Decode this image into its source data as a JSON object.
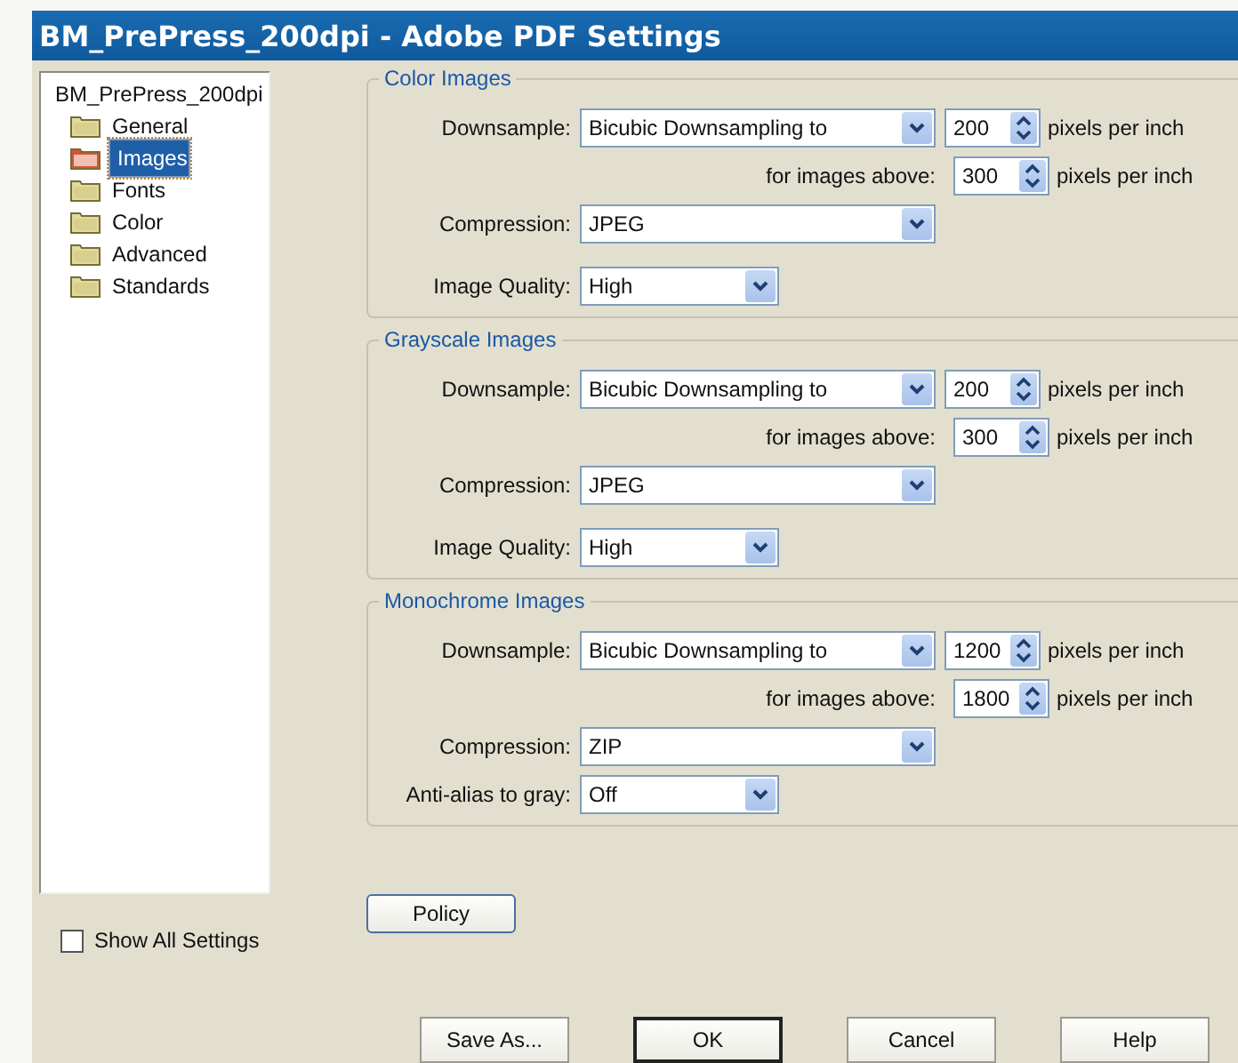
{
  "window": {
    "title": "BM_PrePress_200dpi - Adobe PDF Settings"
  },
  "tree": {
    "root": "BM_PrePress_200dpi",
    "items": [
      {
        "label": "General",
        "selected": false
      },
      {
        "label": "Images",
        "selected": true
      },
      {
        "label": "Fonts",
        "selected": false
      },
      {
        "label": "Color",
        "selected": false
      },
      {
        "label": "Advanced",
        "selected": false
      },
      {
        "label": "Standards",
        "selected": false
      }
    ]
  },
  "show_all_settings": {
    "label": "Show All Settings",
    "checked": false
  },
  "sections": [
    {
      "title": "Color Images",
      "rows": [
        {
          "kind": "select-spin",
          "label": "Downsample:",
          "value": "Bicubic Downsampling to",
          "number": "200",
          "unit": "pixels per inch"
        },
        {
          "kind": "spin",
          "label": "for images above:",
          "number": "300",
          "unit": "pixels per inch"
        },
        {
          "kind": "select-long",
          "label": "Compression:",
          "value": "JPEG"
        },
        {
          "kind": "select-short",
          "label": "Image Quality:",
          "value": "High"
        }
      ]
    },
    {
      "title": "Grayscale Images",
      "rows": [
        {
          "kind": "select-spin",
          "label": "Downsample:",
          "value": "Bicubic Downsampling to",
          "number": "200",
          "unit": "pixels per inch"
        },
        {
          "kind": "spin",
          "label": "for images above:",
          "number": "300",
          "unit": "pixels per inch"
        },
        {
          "kind": "select-long",
          "label": "Compression:",
          "value": "JPEG"
        },
        {
          "kind": "select-short",
          "label": "Image Quality:",
          "value": "High"
        }
      ]
    },
    {
      "title": "Monochrome Images",
      "rows": [
        {
          "kind": "select-spin",
          "label": "Downsample:",
          "value": "Bicubic Downsampling to",
          "number": "1200",
          "unit": "pixels per inch"
        },
        {
          "kind": "spin",
          "label": "for images above:",
          "number": "1800",
          "unit": "pixels per inch"
        },
        {
          "kind": "select-long",
          "label": "Compression:",
          "value": "ZIP"
        },
        {
          "kind": "select-short",
          "label": "Anti-alias to gray:",
          "value": "Off"
        }
      ]
    }
  ],
  "policy_button": "Policy",
  "buttons": [
    {
      "label": "Save As...",
      "default": false
    },
    {
      "label": "OK",
      "default": true
    },
    {
      "label": "Cancel",
      "default": false
    },
    {
      "label": "Help",
      "default": false
    }
  ]
}
